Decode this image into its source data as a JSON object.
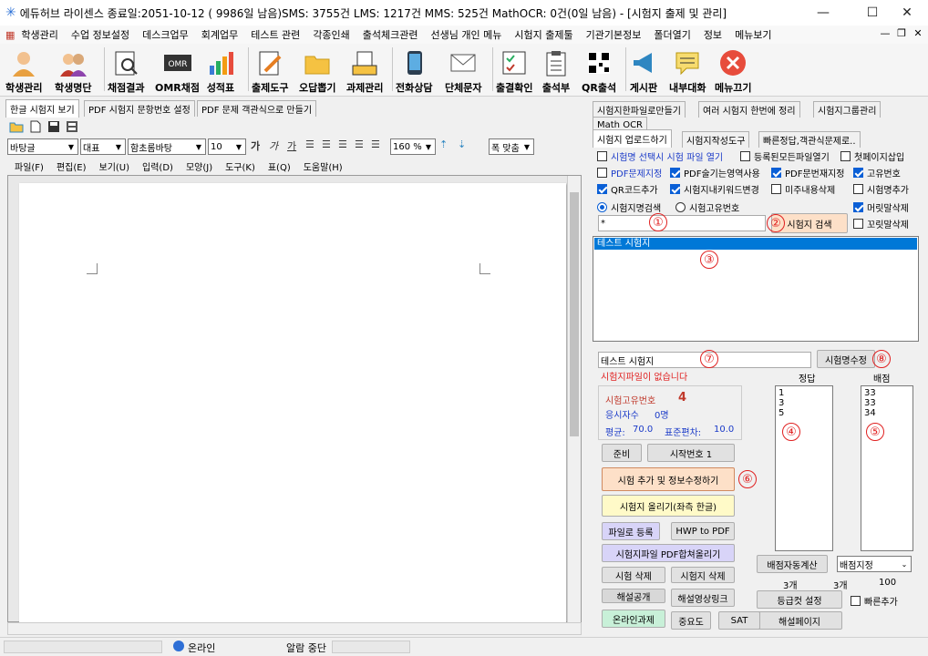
{
  "window": {
    "title": "에듀허브 라이센스 종료일:2051-10-12 ( 9986일 남음)SMS: 3755건 LMS: 1217건 MMS: 525건 MathOCR: 0건(0일 남음) - [시험지 출제 및 관리]"
  },
  "menu": [
    "학생관리",
    "수업 정보설정",
    "데스크업무",
    "회계업무",
    "테스트 관련",
    "각종인쇄",
    "출석체크관련",
    "선생님 개인 메뉴",
    "시험지 출제툴",
    "기관기본정보",
    "폴더열기",
    "정보",
    "메뉴보기"
  ],
  "toolbar": [
    "학생관리",
    "학생명단",
    "채점결과",
    "OMR채점",
    "성적표",
    "출제도구",
    "오답뽑기",
    "과제관리",
    "전화상담",
    "단체문자",
    "출결확인",
    "출석부",
    "QR출석",
    "게시판",
    "내부대화",
    "메뉴끄기"
  ],
  "left_tabs": [
    "한글 시험지 보기",
    "PDF 시험지 문항번호 설정",
    "PDF 문제 객관식으로 만들기"
  ],
  "editor": {
    "style": "바탕글",
    "lang": "대표",
    "font": "함초롬바탕",
    "size": "10",
    "zoom": "160 %",
    "fit": "폭 맞춤",
    "fmt_glyphs": [
      "가",
      "가",
      "가"
    ],
    "menu": [
      "파일(F)",
      "편집(E)",
      "보기(U)",
      "입력(D)",
      "모양(J)",
      "도구(K)",
      "표(Q)",
      "도움말(H)"
    ]
  },
  "right_tabs_row1": [
    "시험지한파일로만들기",
    "여러 시험지 한번에 정리",
    "시험지그룹관리",
    "Math OCR"
  ],
  "right_tabs_row2": [
    "시험지 업로드하기",
    "시험지작성도구",
    "빠른정답,객관식문제로.."
  ],
  "options": {
    "c1": "시험명 선택시 시험 파일 열기",
    "c2": "등록된모든파일열기",
    "c3": "첫페이지삽입",
    "c4": "PDF문제지정",
    "c5": "PDF술기는영역사용",
    "c6": "PDF문번재지정",
    "c7": "고유번호",
    "c8": "QR코드추가",
    "c9": "시험지내키워드변경",
    "c10": "미주내용삭제",
    "c11": "시험명추가",
    "c12": "머릿말삭제",
    "c13": "꼬릿말삭제",
    "r1": "시험지명검색",
    "r2": "시험고유번호"
  },
  "search": {
    "value": "*",
    "button": "시험지 검색"
  },
  "exam_list": [
    "테스트 시험지"
  ],
  "markers": [
    "①",
    "②",
    "③",
    "④",
    "⑤",
    "⑥",
    "⑦",
    "⑧"
  ],
  "exam_name": {
    "value": "테스트 시험지",
    "button": "시험명수정",
    "warning": "시험지파일이 없습니다"
  },
  "info": {
    "id_label": "시험고유번호",
    "id_value": "4",
    "count_label": "응시자수",
    "count_value": "0명",
    "avg_label": "평균:",
    "avg_value": "70.0",
    "std_label": "표준편차:",
    "std_value": "10.0"
  },
  "answers": {
    "header": "정답",
    "values": "1\n3\n5",
    "count": "3개"
  },
  "scores": {
    "header": "배점",
    "values": "33\n33\n34",
    "count": "3개",
    "total": "100",
    "combo": "배점지정",
    "auto_btn": "배점자동계산",
    "grade_btn": "등급컷 설정",
    "quick_add": "빠른추가",
    "explain_page": "해설페이지"
  },
  "buttons": {
    "prep": "준비",
    "start_no": "시작번호 1",
    "add": "시험 추가 및 정보수정하기",
    "upload": "시험지 올리기(좌측 한글)",
    "file_reg": "파일로 등록",
    "hwp2pdf": "HWP to PDF",
    "pdf_upload": "시험지파일 PDF합쳐올리기",
    "del_exam": "시험 삭제",
    "del_paper": "시험지 삭제",
    "explain_open": "해설공개",
    "explain_video": "해설영상링크",
    "online": "온라인과제",
    "importance": "중요도",
    "sat": "SAT"
  },
  "status": {
    "online": "온라인",
    "alarm": "알람 중단"
  },
  "colors": {
    "accent": "#0a5fd6",
    "orange_btn": "#fde0c8",
    "yellow_btn": "#fffac8",
    "purple_btn": "#d8d4f8",
    "green_btn": "#c8f0d8",
    "marker": "#e02020"
  }
}
